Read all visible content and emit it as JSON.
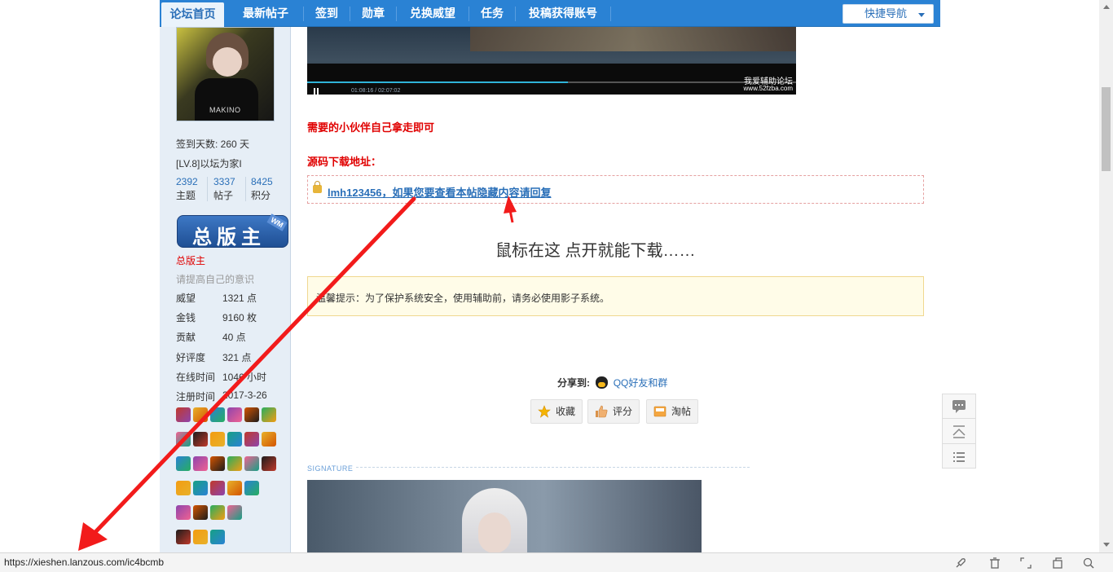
{
  "nav": {
    "tabs": [
      {
        "label": "论坛首页",
        "active": true
      },
      {
        "label": "最新帖子"
      },
      {
        "label": "签到"
      },
      {
        "label": "勋章"
      },
      {
        "label": "兑换威望"
      },
      {
        "label": "任务"
      },
      {
        "label": "投稿获得账号"
      }
    ],
    "quick_nav": "快捷导航"
  },
  "sidebar": {
    "avatar_text": "MAKINO",
    "signin_days": "签到天数: 260 天",
    "level": "[LV.8]以坛为家I",
    "stats": [
      {
        "num": "2392",
        "label": "主题"
      },
      {
        "num": "3337",
        "label": "帖子"
      },
      {
        "num": "8425",
        "label": "积分"
      }
    ],
    "rank_badge": "总版主",
    "rank_badge_tag": "WM",
    "rank_title": "总版主",
    "motto": "请提高自己的意识",
    "fields": [
      {
        "label": "威望",
        "value": "1321 点"
      },
      {
        "label": "金钱",
        "value": "9160 枚"
      },
      {
        "label": "贡献",
        "value": "40 点"
      },
      {
        "label": "好评度",
        "value": "321 点"
      },
      {
        "label": "在线时间",
        "value": "1046 小时"
      },
      {
        "label": "注册时间",
        "value": "2017-3-26"
      }
    ]
  },
  "post": {
    "video_time": "01:08:16 / 02:07:02",
    "video_watermark": "我爱辅助论坛",
    "video_watermark_url": "www.52fzba.com",
    "line1": "需要的小伙伴自己拿走即可",
    "line2": "源码下载地址：",
    "locked_text": "lmh123456，如果您要查看本帖隐藏内容请回复",
    "hint": "鼠标在这    点开就能下载……",
    "tip": "温馨提示：为了保护系统安全，使用辅助前，请务必使用影子系统。",
    "share_label": "分享到:",
    "share_qq": "QQ好友和群",
    "buttons": [
      "收藏",
      "评分",
      "淘帖"
    ],
    "signature_label": "SIGNATURE"
  },
  "statusbar": {
    "url": "https://xieshen.lanzous.com/ic4bcmb"
  },
  "colors": {
    "nav_blue": "#2a82d4",
    "link_blue": "#2a6fb8",
    "red": "#e00000",
    "arrow_red": "#f21b1b"
  }
}
